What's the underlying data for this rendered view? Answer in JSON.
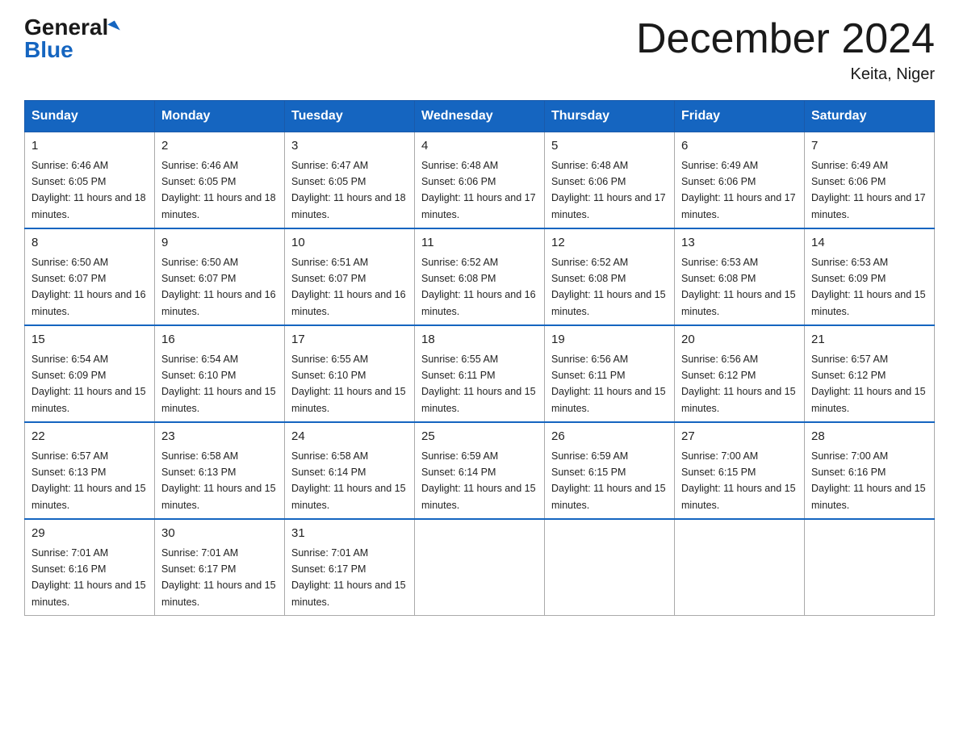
{
  "logo": {
    "general": "General",
    "blue": "Blue"
  },
  "title": "December 2024",
  "location": "Keita, Niger",
  "days_of_week": [
    "Sunday",
    "Monday",
    "Tuesday",
    "Wednesday",
    "Thursday",
    "Friday",
    "Saturday"
  ],
  "weeks": [
    [
      {
        "date": "1",
        "sunrise": "6:46 AM",
        "sunset": "6:05 PM",
        "daylight": "11 hours and 18 minutes."
      },
      {
        "date": "2",
        "sunrise": "6:46 AM",
        "sunset": "6:05 PM",
        "daylight": "11 hours and 18 minutes."
      },
      {
        "date": "3",
        "sunrise": "6:47 AM",
        "sunset": "6:05 PM",
        "daylight": "11 hours and 18 minutes."
      },
      {
        "date": "4",
        "sunrise": "6:48 AM",
        "sunset": "6:06 PM",
        "daylight": "11 hours and 17 minutes."
      },
      {
        "date": "5",
        "sunrise": "6:48 AM",
        "sunset": "6:06 PM",
        "daylight": "11 hours and 17 minutes."
      },
      {
        "date": "6",
        "sunrise": "6:49 AM",
        "sunset": "6:06 PM",
        "daylight": "11 hours and 17 minutes."
      },
      {
        "date": "7",
        "sunrise": "6:49 AM",
        "sunset": "6:06 PM",
        "daylight": "11 hours and 17 minutes."
      }
    ],
    [
      {
        "date": "8",
        "sunrise": "6:50 AM",
        "sunset": "6:07 PM",
        "daylight": "11 hours and 16 minutes."
      },
      {
        "date": "9",
        "sunrise": "6:50 AM",
        "sunset": "6:07 PM",
        "daylight": "11 hours and 16 minutes."
      },
      {
        "date": "10",
        "sunrise": "6:51 AM",
        "sunset": "6:07 PM",
        "daylight": "11 hours and 16 minutes."
      },
      {
        "date": "11",
        "sunrise": "6:52 AM",
        "sunset": "6:08 PM",
        "daylight": "11 hours and 16 minutes."
      },
      {
        "date": "12",
        "sunrise": "6:52 AM",
        "sunset": "6:08 PM",
        "daylight": "11 hours and 15 minutes."
      },
      {
        "date": "13",
        "sunrise": "6:53 AM",
        "sunset": "6:08 PM",
        "daylight": "11 hours and 15 minutes."
      },
      {
        "date": "14",
        "sunrise": "6:53 AM",
        "sunset": "6:09 PM",
        "daylight": "11 hours and 15 minutes."
      }
    ],
    [
      {
        "date": "15",
        "sunrise": "6:54 AM",
        "sunset": "6:09 PM",
        "daylight": "11 hours and 15 minutes."
      },
      {
        "date": "16",
        "sunrise": "6:54 AM",
        "sunset": "6:10 PM",
        "daylight": "11 hours and 15 minutes."
      },
      {
        "date": "17",
        "sunrise": "6:55 AM",
        "sunset": "6:10 PM",
        "daylight": "11 hours and 15 minutes."
      },
      {
        "date": "18",
        "sunrise": "6:55 AM",
        "sunset": "6:11 PM",
        "daylight": "11 hours and 15 minutes."
      },
      {
        "date": "19",
        "sunrise": "6:56 AM",
        "sunset": "6:11 PM",
        "daylight": "11 hours and 15 minutes."
      },
      {
        "date": "20",
        "sunrise": "6:56 AM",
        "sunset": "6:12 PM",
        "daylight": "11 hours and 15 minutes."
      },
      {
        "date": "21",
        "sunrise": "6:57 AM",
        "sunset": "6:12 PM",
        "daylight": "11 hours and 15 minutes."
      }
    ],
    [
      {
        "date": "22",
        "sunrise": "6:57 AM",
        "sunset": "6:13 PM",
        "daylight": "11 hours and 15 minutes."
      },
      {
        "date": "23",
        "sunrise": "6:58 AM",
        "sunset": "6:13 PM",
        "daylight": "11 hours and 15 minutes."
      },
      {
        "date": "24",
        "sunrise": "6:58 AM",
        "sunset": "6:14 PM",
        "daylight": "11 hours and 15 minutes."
      },
      {
        "date": "25",
        "sunrise": "6:59 AM",
        "sunset": "6:14 PM",
        "daylight": "11 hours and 15 minutes."
      },
      {
        "date": "26",
        "sunrise": "6:59 AM",
        "sunset": "6:15 PM",
        "daylight": "11 hours and 15 minutes."
      },
      {
        "date": "27",
        "sunrise": "7:00 AM",
        "sunset": "6:15 PM",
        "daylight": "11 hours and 15 minutes."
      },
      {
        "date": "28",
        "sunrise": "7:00 AM",
        "sunset": "6:16 PM",
        "daylight": "11 hours and 15 minutes."
      }
    ],
    [
      {
        "date": "29",
        "sunrise": "7:01 AM",
        "sunset": "6:16 PM",
        "daylight": "11 hours and 15 minutes."
      },
      {
        "date": "30",
        "sunrise": "7:01 AM",
        "sunset": "6:17 PM",
        "daylight": "11 hours and 15 minutes."
      },
      {
        "date": "31",
        "sunrise": "7:01 AM",
        "sunset": "6:17 PM",
        "daylight": "11 hours and 15 minutes."
      },
      null,
      null,
      null,
      null
    ]
  ]
}
